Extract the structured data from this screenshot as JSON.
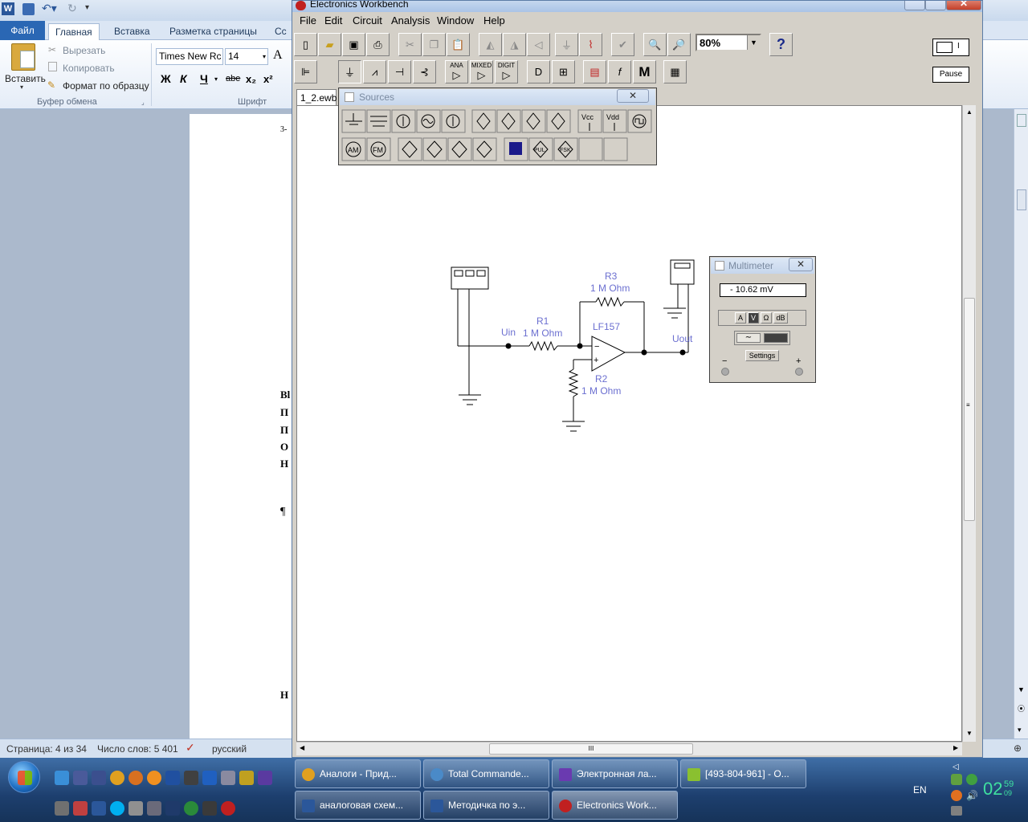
{
  "word": {
    "file_tab": "Файл",
    "tabs": [
      "Главная",
      "Вставка",
      "Разметка страницы",
      "Сс"
    ],
    "clipboard": {
      "paste": "Вставить",
      "cut": "Вырезать",
      "copy": "Копировать",
      "format_painter": "Формат по образцу",
      "group": "Буфер обмена"
    },
    "font": {
      "name": "Times New Rc",
      "size": "14",
      "group": "Шрифт",
      "bold": "Ж",
      "italic": "К",
      "underline": "Ч",
      "strike": "abe",
      "sub": "x₂",
      "sup": "x²",
      "grow": "A"
    },
    "page_fragments": [
      "3-",
      "Bl",
      "П",
      "П",
      "О",
      "Н",
      "¶",
      "Н"
    ],
    "status": {
      "page": "Страница: 4 из 34",
      "words": "Число слов: 5 401",
      "lang": "русский"
    }
  },
  "ewb": {
    "title": "Electronics Workbench",
    "menu": [
      "File",
      "Edit",
      "Circuit",
      "Analysis",
      "Window",
      "Help"
    ],
    "zoom": "80%",
    "help_label": "?",
    "pause_label": "Pause",
    "toggle_label": "I",
    "parts_labels": {
      "ana": "ANA",
      "mixed": "MIXED",
      "digit": "DIGIT",
      "misc": "M"
    },
    "doc_tab": "1_2.ewb",
    "sources_title": "Sources",
    "sources_labels": {
      "vcc": "Vcc",
      "vdd": "Vdd",
      "am": "AM",
      "fm": "FM",
      "pul": "PUL",
      "fsk": "FSK"
    },
    "circuit": {
      "r1": {
        "name": "R1",
        "value": "1 M Ohm"
      },
      "r2": {
        "name": "R2",
        "value": "1 M Ohm"
      },
      "r3": {
        "name": "R3",
        "value": "1 M Ohm"
      },
      "opamp": "LF157",
      "uin": "Uin",
      "uout": "Uout",
      "minus": "−",
      "plus": "+"
    },
    "multimeter": {
      "title": "Multimeter",
      "reading": "- 10.62  mV",
      "modes": [
        "A",
        "V",
        "Ω",
        "dB"
      ],
      "settings": "Settings",
      "minus": "−",
      "plus": "+"
    },
    "hscroll_grip": "III"
  },
  "taskbar": {
    "row1": [
      "Аналоги - Прид...",
      "Total Commande...",
      "Электронная ла...",
      "[493-804-961] - О..."
    ],
    "row2": [
      "аналоговая схем...",
      "Методичка по э...",
      "Electronics Work..."
    ],
    "lang": "EN",
    "time": "02",
    "time_min": "59",
    "time_sec": "09"
  }
}
